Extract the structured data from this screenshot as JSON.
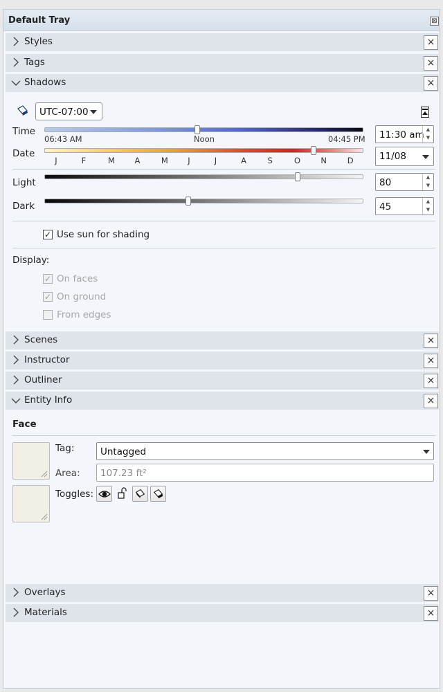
{
  "tray": {
    "title": "Default Tray",
    "close_glyph": "⊠"
  },
  "panels": {
    "styles": {
      "label": "Styles",
      "icon": "chevron-right-icon"
    },
    "tags": {
      "label": "Tags",
      "icon": "chevron-right-icon"
    },
    "shadows": {
      "label": "Shadows",
      "icon": "chevron-down-icon"
    },
    "scenes": {
      "label": "Scenes",
      "icon": "chevron-right-icon"
    },
    "instructor": {
      "label": "Instructor",
      "icon": "chevron-right-icon"
    },
    "outliner": {
      "label": "Outliner",
      "icon": "chevron-right-icon"
    },
    "entity_info": {
      "label": "Entity Info",
      "icon": "chevron-down-icon"
    },
    "overlays": {
      "label": "Overlays",
      "icon": "chevron-right-icon"
    },
    "materials": {
      "label": "Materials",
      "icon": "chevron-right-icon"
    }
  },
  "close_glyph": "×",
  "shadows": {
    "timezone": "UTC-07:00",
    "time": {
      "label": "Time",
      "start": "06:43 AM",
      "middle": "Noon",
      "end": "04:45 PM",
      "value": "11:30 am",
      "slider_fraction": 0.48
    },
    "date": {
      "label": "Date",
      "months": [
        "J",
        "F",
        "M",
        "A",
        "M",
        "J",
        "J",
        "A",
        "S",
        "O",
        "N",
        "D"
      ],
      "value": "11/08",
      "slider_fraction": 0.85
    },
    "light": {
      "label": "Light",
      "value": "80",
      "slider_fraction": 0.8
    },
    "dark": {
      "label": "Dark",
      "value": "45",
      "slider_fraction": 0.45
    },
    "use_sun": {
      "label": "Use sun for shading",
      "checked": true
    },
    "display": {
      "label": "Display:",
      "on_faces": {
        "label": "On faces",
        "checked": true,
        "enabled": false
      },
      "on_ground": {
        "label": "On ground",
        "checked": true,
        "enabled": false
      },
      "from_edges": {
        "label": "From edges",
        "checked": false,
        "enabled": false
      }
    },
    "colors": {
      "time_start": "#a9c4e4",
      "time_mid": "#5a6fe0",
      "time_end": "#0d0d1d"
    }
  },
  "entity_info": {
    "heading": "Face",
    "tag_label": "Tag:",
    "tag_value": "Untagged",
    "area_label": "Area:",
    "area_value": "107.23 ft²",
    "toggles_label": "Toggles:",
    "swatch_color": "#f2f0e4"
  }
}
